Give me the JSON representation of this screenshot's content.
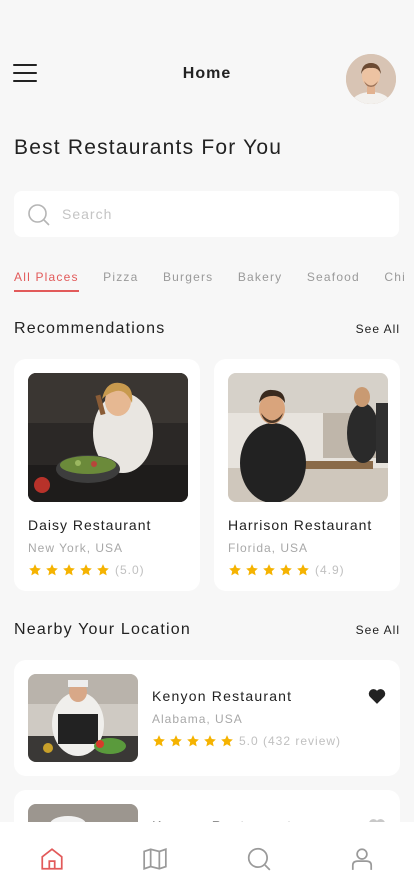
{
  "header": {
    "title": "Home"
  },
  "page_title": "Best Restaurants For You",
  "search": {
    "placeholder": "Search",
    "value": ""
  },
  "categories": [
    "All Places",
    "Pizza",
    "Burgers",
    "Bakery",
    "Seafood",
    "Chi"
  ],
  "active_category": "All Places",
  "recommendations": {
    "title": "Recommendations",
    "see_all": "See All",
    "items": [
      {
        "name": "Daisy Restaurant",
        "location": "New York, USA",
        "stars": 5,
        "rating_text": "(5.0)"
      },
      {
        "name": "Harrison Restaurant",
        "location": "Florida, USA",
        "stars": 5,
        "rating_text": "(4.9)"
      }
    ]
  },
  "nearby": {
    "title": "Nearby Your Location",
    "see_all": "See All",
    "items": [
      {
        "name": "Kenyon Restaurant",
        "location": "Alabama, USA",
        "stars": 5,
        "rating_text": "5.0 (432 review)",
        "favorite": true
      },
      {
        "name": "Kenyon Restaurant",
        "location": "",
        "stars": 0,
        "rating_text": "",
        "favorite": false
      }
    ]
  },
  "bottom_nav": [
    "home-icon",
    "map-icon",
    "search-icon",
    "profile-icon"
  ],
  "colors": {
    "accent": "#e25a5a",
    "star": "#f5b301",
    "background": "#f7f7f7"
  }
}
